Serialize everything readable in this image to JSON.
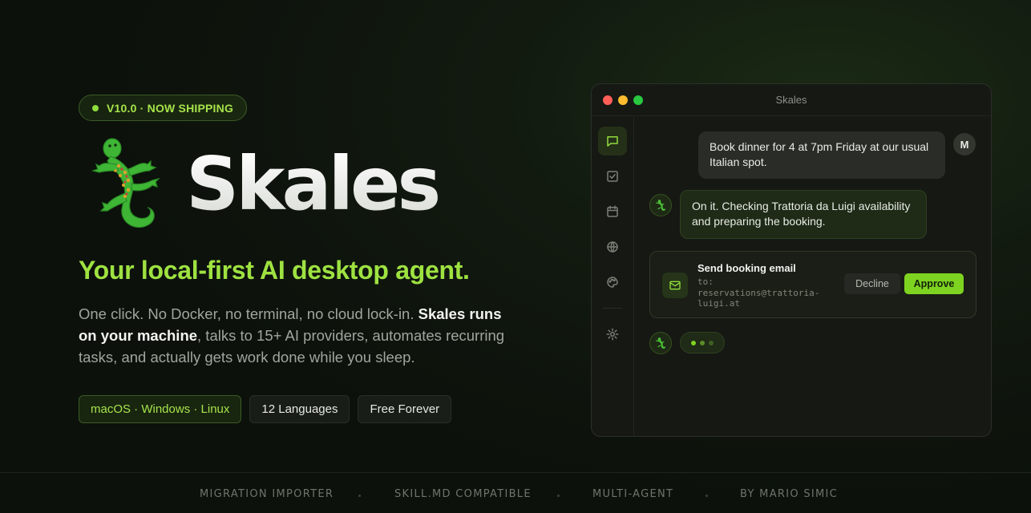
{
  "hero": {
    "version_badge": "V10.0 · NOW SHIPPING",
    "brand_name": "Skales",
    "tagline": "Your local-first AI desktop agent.",
    "description": {
      "part1": "One click. No Docker, no terminal, no cloud lock-in. ",
      "bold1": "Skales runs on your machine",
      "part2": ", talks to 15+ AI providers, automates recurring tasks, and actually gets work done while you sleep."
    },
    "chips": [
      {
        "label": "macOS · Windows · Linux"
      },
      {
        "label": "12 Languages"
      },
      {
        "label": "Free Forever"
      }
    ]
  },
  "window": {
    "title": "Skales",
    "sidebar_icons": [
      "chat-icon",
      "checklist-icon",
      "calendar-icon",
      "globe-icon",
      "palette-icon",
      "settings-icon"
    ],
    "user_message": "Book dinner for 4 at 7pm Friday at our usual Italian spot.",
    "user_avatar": "M",
    "bot_message": "On it. Checking Trattoria da Luigi availability and preparing the booking.",
    "action": {
      "title": "Send booking email",
      "to": "to: reservations@trattoria-luigi.at",
      "decline_label": "Decline",
      "approve_label": "Approve"
    }
  },
  "footer": {
    "items": [
      "MIGRATION IMPORTER",
      "SKILL.MD COMPATIBLE",
      "MULTI-AGENT",
      "BY MARIO SIMIC"
    ]
  },
  "colors": {
    "accent": "#9ee241",
    "approve": "#7ed321",
    "background": "#0e140c"
  }
}
